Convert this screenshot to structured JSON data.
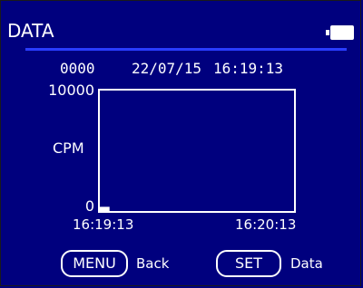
{
  "header": {
    "title": "DATA",
    "battery_icon": "battery-full-icon"
  },
  "info": {
    "record": "0000",
    "date": "22/07/15",
    "time": "16:19:13"
  },
  "chart_data": {
    "type": "area",
    "ylabel": "CPM",
    "ylim": [
      0,
      10000
    ],
    "y_ticks": [
      "10000",
      "0"
    ],
    "x_ticks": [
      "16:19:13",
      "16:20:13"
    ],
    "x": [
      "16:19:13",
      "16:19:16"
    ],
    "series": [
      {
        "values": [
          350,
          350
        ]
      }
    ],
    "grid": false
  },
  "footer": {
    "menu_label": "MENU",
    "menu_hint": "Back",
    "set_label": "SET",
    "set_hint": "Data"
  },
  "colors": {
    "background": "#00007e",
    "foreground": "#ffffff",
    "divider": "#2a3cff"
  }
}
